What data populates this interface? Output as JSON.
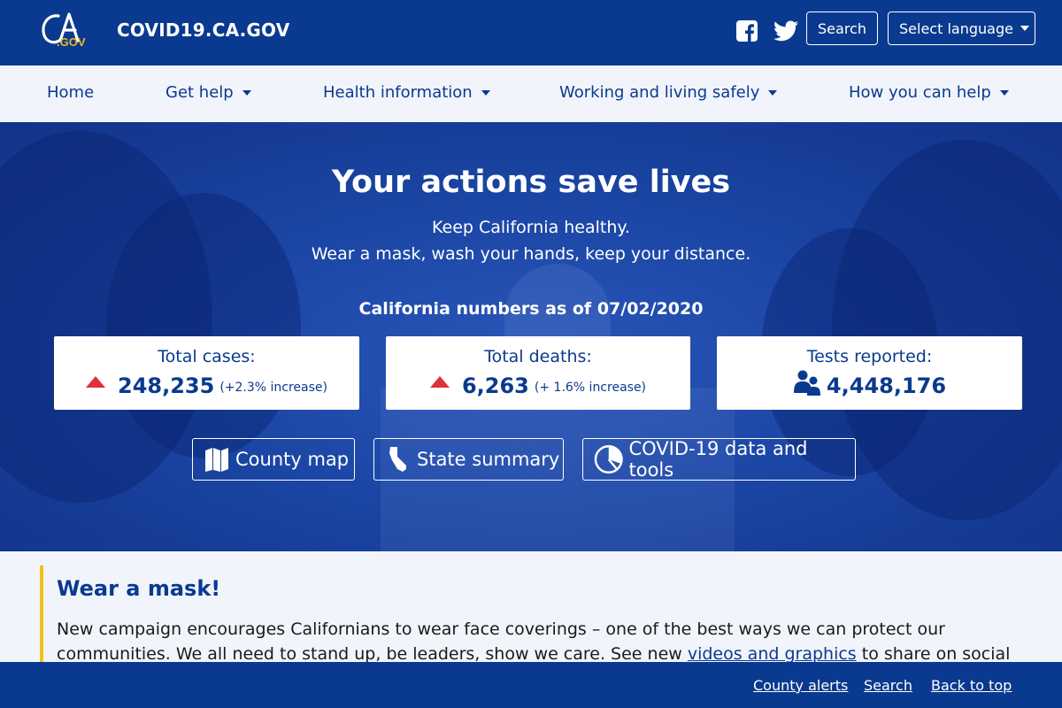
{
  "header": {
    "logo_text": "CA.GOV",
    "site_name": "COVID19.CA.GOV",
    "facebook_icon": "facebook-icon",
    "twitter_icon": "twitter-icon",
    "search_label": "Search",
    "language_label": "Select language"
  },
  "nav": {
    "items": [
      {
        "label": "Home"
      },
      {
        "label": "Get help"
      },
      {
        "label": "Health information"
      },
      {
        "label": "Working and living safely"
      },
      {
        "label": "How you can help"
      }
    ]
  },
  "hero": {
    "title": "Your actions save lives",
    "subtitle_line1": "Keep California healthy.",
    "subtitle_line2": "Wear a mask, wash your hands, keep your distance.",
    "numbers_heading": "California numbers as of 07/02/2020",
    "stats": [
      {
        "label": "Total cases:",
        "value": "248,235",
        "change": "(+2.3% increase)",
        "icon": "increase-triangle-icon"
      },
      {
        "label": "Total deaths:",
        "value": "6,263",
        "change": "(+ 1.6% increase)",
        "icon": "increase-triangle-icon"
      },
      {
        "label": "Tests reported:",
        "value": "4,448,176",
        "change": "",
        "icon": "people-icon"
      }
    ],
    "buttons": [
      {
        "label": "County map",
        "icon": "map-icon"
      },
      {
        "label": "State summary",
        "icon": "california-icon"
      },
      {
        "label": "COVID-19 data and tools",
        "icon": "pie-chart-icon"
      }
    ]
  },
  "callout": {
    "title": "Wear a mask!",
    "text_before": "New campaign encourages Californians to wear face coverings – one of the best ways we can protect our communities. We all need to stand up, be leaders, show we care. See new ",
    "link_text": "videos and graphics",
    "text_after": " to share on social media and with your"
  },
  "footer": {
    "links": [
      {
        "label": "County alerts"
      },
      {
        "label": "Search"
      },
      {
        "label": "Back to top"
      }
    ]
  },
  "colors": {
    "primary": "#0a3a8f",
    "accent": "#f0c418",
    "alert": "#e0303a"
  }
}
